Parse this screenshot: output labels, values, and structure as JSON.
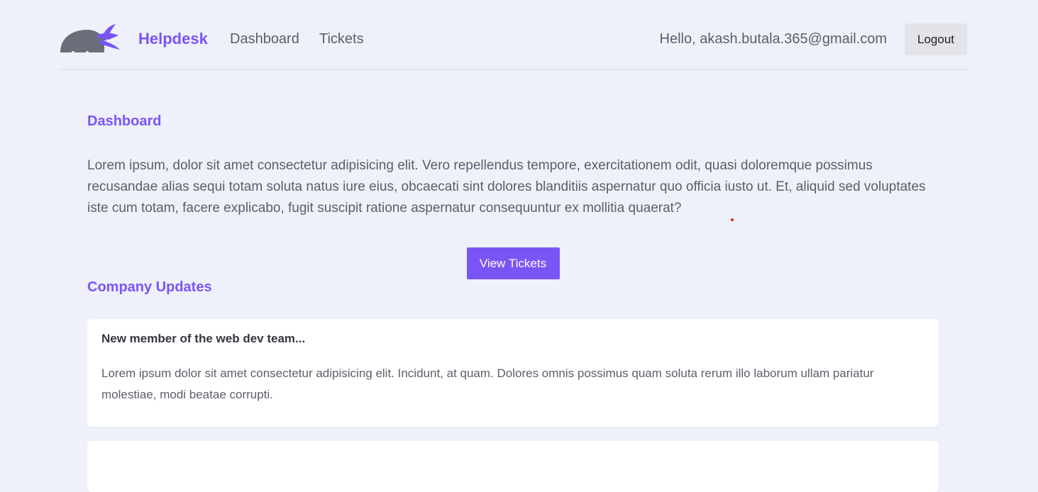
{
  "header": {
    "brand": "Helpdesk",
    "nav": [
      "Dashboard",
      "Tickets"
    ],
    "greeting": "Hello, akash.butala.365@gmail.com",
    "logout_label": "Logout"
  },
  "dashboard": {
    "title": "Dashboard",
    "intro": "Lorem ipsum, dolor sit amet consectetur adipisicing elit. Vero repellendus tempore, exercitationem odit, quasi doloremque possimus recusandae alias sequi totam soluta natus iure eius, obcaecati sint dolores blanditiis aspernatur quo officia iusto ut. Et, aliquid sed voluptates iste cum totam, facere explicabo, fugit suscipit ratione aspernatur consequuntur ex mollitia quaerat?",
    "view_tickets_label": "View Tickets"
  },
  "updates": {
    "title": "Company Updates",
    "items": [
      {
        "title": "New member of the web dev team...",
        "body": "Lorem ipsum dolor sit amet consectetur adipisicing elit. Incidunt, at quam. Dolores omnis possimus quam soluta rerum illo laborum ullam pariatur molestiae, modi beatae corrupti."
      },
      {
        "title": "",
        "body": ""
      }
    ]
  },
  "colors": {
    "accent": "#7a55f5",
    "background": "#eef0fa",
    "logo_gray": "#6b6e78"
  },
  "icons": {
    "logo": "ninja-logo-icon"
  }
}
